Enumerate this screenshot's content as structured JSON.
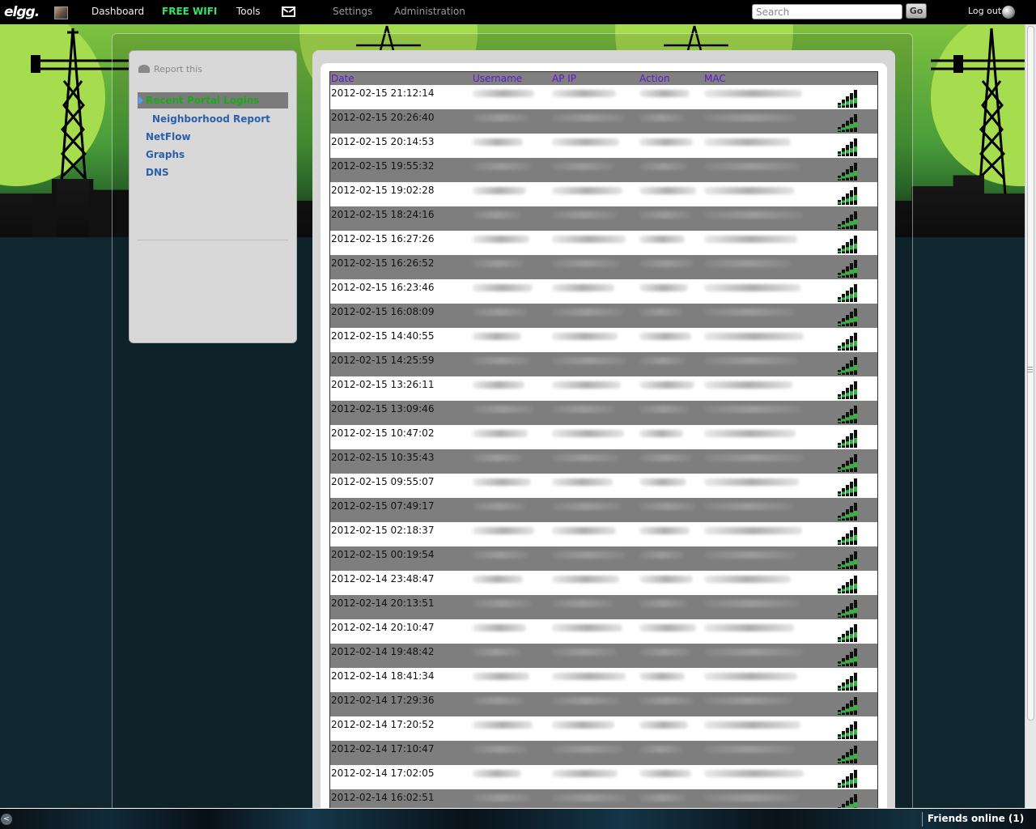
{
  "topbar": {
    "logo": "elgg.",
    "nav": {
      "dashboard": "Dashboard",
      "free_wifi": "FREE WIFI",
      "tools": "Tools",
      "settings": "Settings",
      "administration": "Administration"
    },
    "search_placeholder": "Search",
    "go": "Go",
    "logout": "Log out"
  },
  "sidebar": {
    "report": "Report this",
    "items": [
      {
        "label": "Recent Portal Logins",
        "active": true
      },
      {
        "label": "Neighborhood Report",
        "sub": true
      },
      {
        "label": "NetFlow"
      },
      {
        "label": "Graphs"
      },
      {
        "label": "DNS"
      }
    ]
  },
  "table": {
    "headers": {
      "date": "Date",
      "username": "Username",
      "ap_ip": "AP IP",
      "action": "Action",
      "mac": "MAC"
    },
    "rows": [
      "2012-02-15 21:12:14",
      "2012-02-15 20:26:40",
      "2012-02-15 20:14:53",
      "2012-02-15 19:55:32",
      "2012-02-15 19:02:28",
      "2012-02-15 18:24:16",
      "2012-02-15 16:27:26",
      "2012-02-15 16:26:52",
      "2012-02-15 16:23:46",
      "2012-02-15 16:08:09",
      "2012-02-15 14:40:55",
      "2012-02-15 14:25:59",
      "2012-02-15 13:26:11",
      "2012-02-15 13:09:46",
      "2012-02-15 10:47:02",
      "2012-02-15 10:35:43",
      "2012-02-15 09:55:07",
      "2012-02-15 07:49:17",
      "2012-02-15 02:18:37",
      "2012-02-15 00:19:54",
      "2012-02-14 23:48:47",
      "2012-02-14 20:13:51",
      "2012-02-14 20:10:47",
      "2012-02-14 19:48:42",
      "2012-02-14 18:41:34",
      "2012-02-14 17:29:36",
      "2012-02-14 17:20:52",
      "2012-02-14 17:10:47",
      "2012-02-14 17:02:05",
      "2012-02-14 16:02:51"
    ]
  },
  "bottombar": {
    "friends_online": "Friends online (1)"
  },
  "colors": {
    "accent_green": "#2ee56a",
    "link_blue": "#2a5faa",
    "header_purple": "#5a1ad1",
    "row_stripe": "#7e7e7e"
  }
}
